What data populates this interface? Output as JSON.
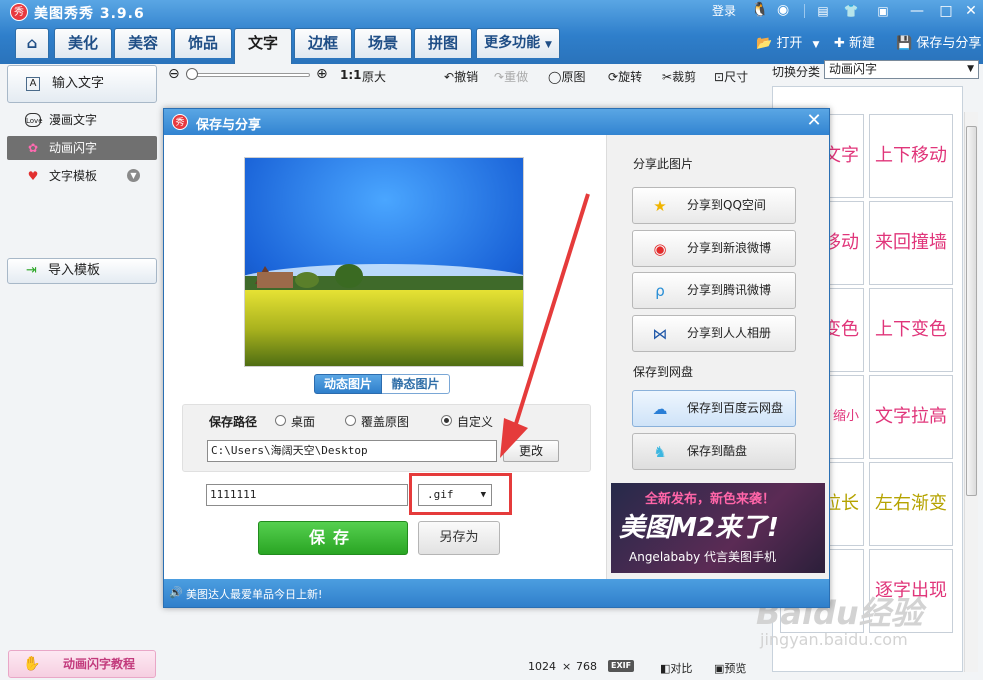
{
  "app": {
    "title": "美图秀秀 3.9.6",
    "icon_label": "秀"
  },
  "titlebar": {
    "login": "登录",
    "min": "—",
    "max": "□",
    "close": "✕"
  },
  "tabs": [
    {
      "label": "美化"
    },
    {
      "label": "美容"
    },
    {
      "label": "饰品"
    },
    {
      "label": "文字"
    },
    {
      "label": "边框"
    },
    {
      "label": "场景"
    },
    {
      "label": "拼图"
    }
  ],
  "tab_more": "更多功能",
  "top_actions": {
    "open": "打开",
    "new": "新建",
    "save_share": "保存与分享"
  },
  "toolbar": {
    "ratio": "1:1",
    "original_size": "原大",
    "undo": "撤销",
    "redo": "重做",
    "original": "原图",
    "rotate": "旋转",
    "crop": "裁剪",
    "size": "尺寸",
    "zoom_percent": 20
  },
  "sidebar": {
    "input_text": "输入文字",
    "items": [
      {
        "label": "漫画文字",
        "icon": "Love"
      },
      {
        "label": "动画闪字",
        "icon": "✿"
      },
      {
        "label": "文字模板",
        "icon": "♥"
      }
    ],
    "import_template": "导入模板",
    "tutorial": "动画闪字教程"
  },
  "right_panel": {
    "switch_label": "切换分类",
    "category": "动画闪字",
    "effects": [
      [
        "文字",
        "上下移动"
      ],
      [
        "移动",
        "来回撞墙"
      ],
      [
        "变色",
        "上下变色"
      ],
      [
        "缩小",
        "文字拉高"
      ],
      [
        "拉长",
        "左右渐变"
      ],
      [
        "",
        "逐字出现"
      ]
    ],
    "effect_colors": [
      "#e0357a",
      "#e0357a",
      "#e0357a",
      "#e0357a",
      "#b5a300",
      "#e0357a"
    ]
  },
  "status": {
    "width": "1024",
    "times": "×",
    "height": "768",
    "exif": "EXIF",
    "compare": "对比",
    "preview": "预览"
  },
  "watermark": {
    "main": "Baidu经验",
    "sub": "jingyan.baidu.com"
  },
  "dialog": {
    "title": "保存与分享",
    "close": "✕",
    "seg_anim": "动态图片",
    "seg_static": "静态图片",
    "save_path_label": "保存路径",
    "radio_desktop": "桌面",
    "radio_overwrite": "覆盖原图",
    "radio_custom": "自定义",
    "path_value": "C:\\Users\\海阔天空\\Desktop",
    "change": "更改",
    "filename": "1111111",
    "ext": ".gif",
    "save": "保存",
    "save_as": "另存为",
    "share_section": "分享此图片",
    "share_buttons": [
      {
        "label": "分享到QQ空间",
        "icon": "★",
        "color": "#f0b400"
      },
      {
        "label": "分享到新浪微博",
        "icon": "◉",
        "color": "#e42a2a"
      },
      {
        "label": "分享到腾讯微博",
        "icon": "ρ",
        "color": "#2a8fd6"
      },
      {
        "label": "分享到人人相册",
        "icon": "⋈",
        "color": "#1f57a8"
      }
    ],
    "cloud_section": "保存到网盘",
    "cloud_buttons": [
      {
        "label": "保存到百度云网盘",
        "icon": "☁",
        "color": "#2a7ed6"
      },
      {
        "label": "保存到酷盘",
        "icon": "♞",
        "color": "#3bb6e0"
      }
    ],
    "ad": {
      "line1": "全新发布，新色来袭！",
      "line2": "美图M2来了!",
      "line3": "Angelababy 代言美图手机"
    },
    "footer": "美图达人最爱单品今日上新!"
  }
}
